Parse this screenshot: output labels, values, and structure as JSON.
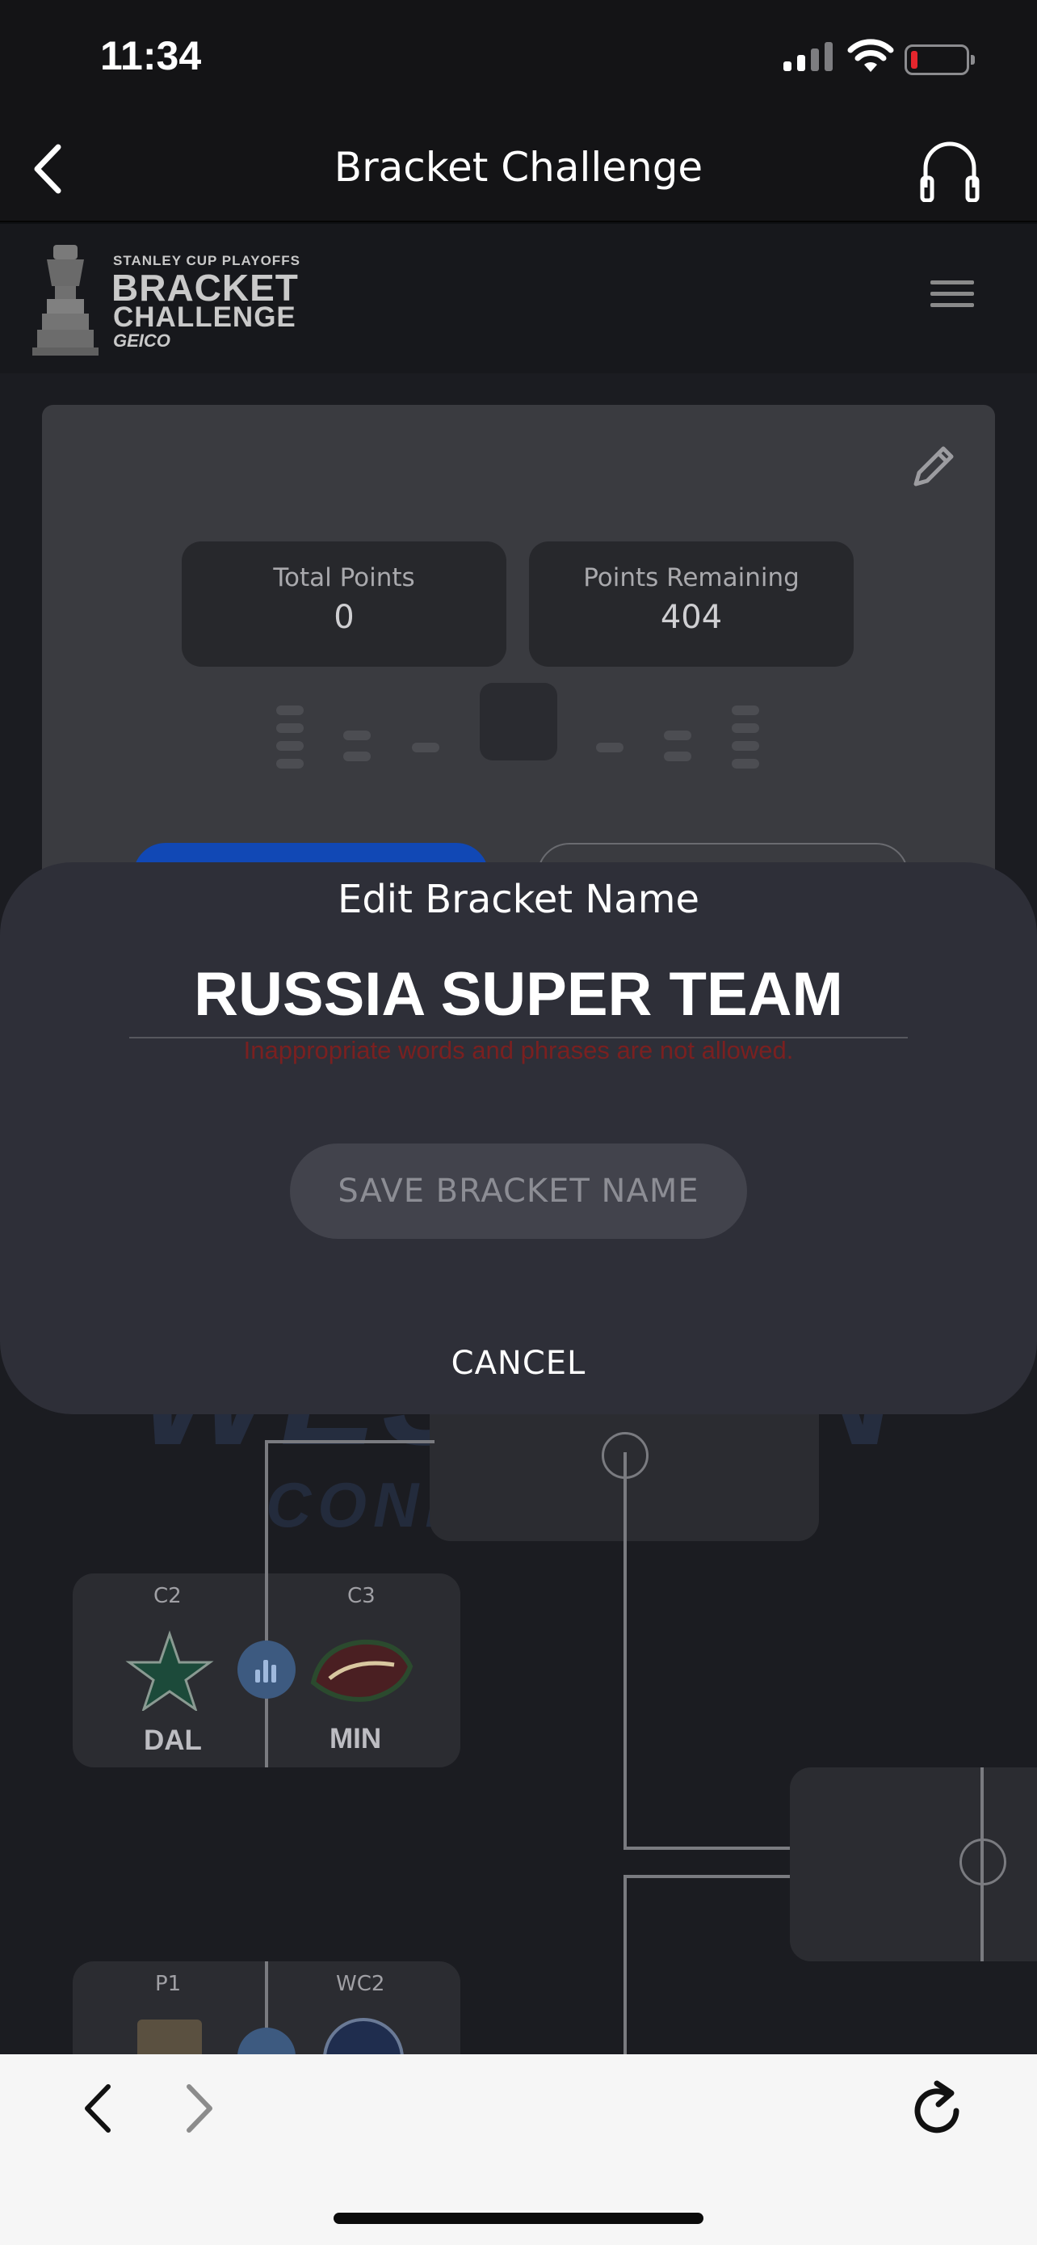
{
  "status_bar": {
    "time": "11:34"
  },
  "nav": {
    "title": "Bracket Challenge"
  },
  "site": {
    "logo": {
      "tagline": "STANLEY CUP PLAYOFFS",
      "line1": "BRACKET",
      "line2": "CHALLENGE",
      "sponsor": "GEICO"
    }
  },
  "stats": {
    "total_points_label": "Total Points",
    "total_points_value": "0",
    "points_remaining_label": "Points Remaining",
    "points_remaining_value": "404"
  },
  "matchups": [
    {
      "seed_a": "C2",
      "team_a": "DAL",
      "seed_b": "C3",
      "team_b": "MIN"
    },
    {
      "seed_a": "P1",
      "seed_b": "WC2"
    }
  ],
  "background_watermark": {
    "line1": "WESTERN",
    "line2": "CONFERENCE"
  },
  "modal": {
    "heading": "Edit Bracket Name",
    "name_value": "RUSSIA SUPER TEAM",
    "error": "Inappropriate words and phrases are not allowed.",
    "save_label": "SAVE BRACKET NAME",
    "cancel_label": "CANCEL"
  },
  "colors": {
    "accent_blue": "#1148b5",
    "error_red": "#7a2020",
    "modal_bg": "#2e2f38",
    "battery_low": "#e5262d"
  },
  "icons": [
    "back-chevron-icon",
    "headphones-icon",
    "hamburger-menu-icon",
    "pencil-icon",
    "stats-icon",
    "reload-icon",
    "forward-chevron-icon"
  ]
}
